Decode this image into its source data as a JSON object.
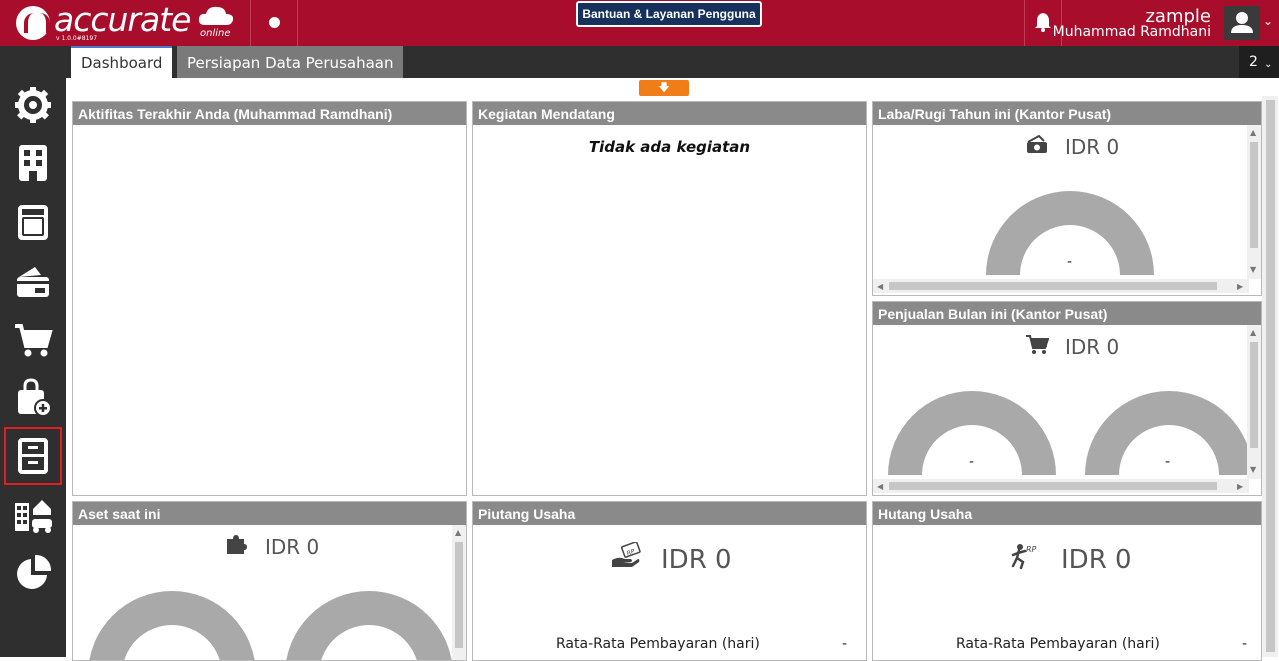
{
  "app": {
    "logo_text": "accurate",
    "logo_sub": "online",
    "version": "v 1.0.0#8197",
    "help_button": "Bantuan & Layanan Pengguna",
    "user_company": "zample",
    "user_name": "Muhammad Ramdhani",
    "brand_color": "#a80e2c"
  },
  "tabs": [
    {
      "label": "Dashboard",
      "active": true
    },
    {
      "label": "Persiapan Data Perusahaan",
      "active": false
    }
  ],
  "tab_count": "2",
  "sidebar": {
    "items": [
      {
        "icon": "gear-icon"
      },
      {
        "icon": "building-icon"
      },
      {
        "icon": "ledger-icon"
      },
      {
        "icon": "wallet-icon"
      },
      {
        "icon": "cart-icon"
      },
      {
        "icon": "shopping-bag-add-icon"
      },
      {
        "icon": "cabinet-icon",
        "active": true
      },
      {
        "icon": "company-assets-icon"
      },
      {
        "icon": "pie-chart-icon"
      }
    ]
  },
  "panels": {
    "activity": {
      "title": "Aktifitas Terakhir Anda (Muhammad Ramdhani)"
    },
    "events": {
      "title": "Kegiatan Mendatang",
      "empty_msg": "Tidak ada kegiatan"
    },
    "profit": {
      "title": "Laba/Rugi Tahun ini (Kantor Pusat)",
      "value": "IDR 0",
      "gauge_value": "-"
    },
    "sales": {
      "title": "Penjualan Bulan ini (Kantor Pusat)",
      "value": "IDR 0",
      "gauge_values": [
        "-",
        "-"
      ]
    },
    "assets": {
      "title": "Aset saat ini",
      "value": "IDR 0"
    },
    "receivable": {
      "title": "Piutang Usaha",
      "value": "IDR 0",
      "avg_label": "Rata-Rata Pembayaran (hari)",
      "avg_value": "-"
    },
    "payable": {
      "title": "Hutang Usaha",
      "value": "IDR 0",
      "avg_label": "Rata-Rata Pembayaran (hari)",
      "avg_value": "-"
    }
  }
}
